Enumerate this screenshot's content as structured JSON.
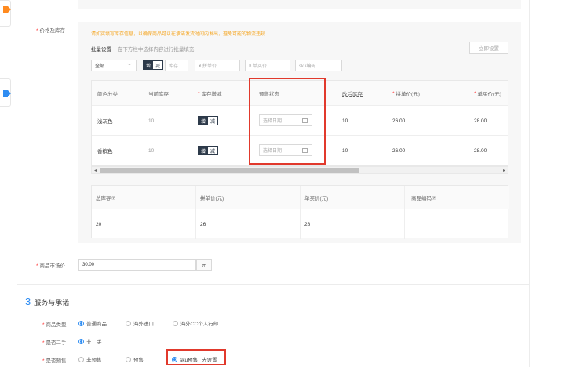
{
  "price_stock": {
    "label": "价格及库存",
    "notice": "请如实填写库存信息，以确保商品可以在承诺发货时间内发出，避免可能的物流违规",
    "batch_label": "批量设置",
    "batch_hint": "在下方栏中选择内容进行批量填充",
    "apply_button": "立即设置",
    "batch_select": "全部",
    "batch_toggle_on": "增",
    "batch_toggle_off": "减",
    "batch_stock_placeholder": "库存",
    "batch_group_placeholder": "¥  拼单价",
    "batch_single_placeholder": "¥  单买价",
    "batch_sku_placeholder": "sku编码",
    "columns": [
      "颜色分类",
      "当前库存",
      "库存增减",
      "预售状态",
      "改后库存",
      "拼单价(元)",
      "单买价(元)"
    ],
    "rows": [
      {
        "color": "浅灰色",
        "stock": "10",
        "toggle_on": "增",
        "toggle_off": "减",
        "date_placeholder": "选择日期",
        "new_stock": "10",
        "group_price": "26.00",
        "single_price": "28.00"
      },
      {
        "color": "香槟色",
        "stock": "10",
        "toggle_on": "增",
        "toggle_off": "减",
        "date_placeholder": "选择日期",
        "new_stock": "10",
        "group_price": "26.00",
        "single_price": "28.00"
      }
    ],
    "summary_headers": [
      "总库存⑦",
      "拼单价(元)",
      "单买价(元)",
      "商品编码⑦"
    ],
    "summary_values": [
      "20",
      "26",
      "28",
      ""
    ]
  },
  "market_price": {
    "label": "商品市场价",
    "value": "30.00",
    "unit": "元"
  },
  "service": {
    "number": "3",
    "title": "服务与承诺",
    "type_label": "商品类型",
    "type_options": [
      "普通商品",
      "海外进口",
      "海外CC个人行邮"
    ],
    "second_hand_label": "是否二手",
    "second_hand_option": "非二手",
    "presale_label": "是否预售",
    "presale_options": [
      "非预售",
      "预售"
    ],
    "sku_presale_option": "sku预售",
    "sku_presale_link": "去设置"
  },
  "colors": {
    "notice": "#f5a623",
    "required": "#ff3333",
    "accent": "#2f8df2",
    "highlight_box": "#e1392c",
    "nav_orange": "#ff8a1f"
  }
}
